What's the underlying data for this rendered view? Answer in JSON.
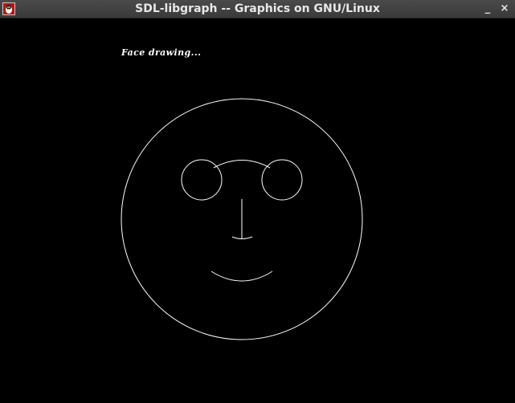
{
  "window": {
    "title": "SDL-libgraph -- Graphics on GNU/Linux",
    "app_icon": "sdl-app-icon",
    "minimize_label": "_",
    "close_label": "×"
  },
  "canvas": {
    "caption": "Face drawing...",
    "background_color": "#000000",
    "stroke_color": "#ffffff"
  }
}
